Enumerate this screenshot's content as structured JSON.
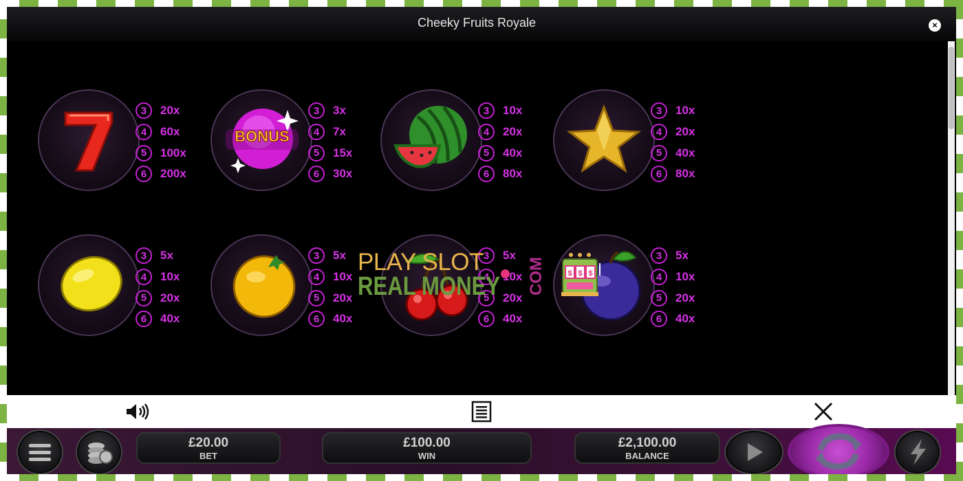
{
  "window": {
    "title": "Cheeky Fruits Royale",
    "close_label": "×"
  },
  "paytable": {
    "symbols": [
      {
        "name": "seven-icon",
        "pays": [
          {
            "n": "3",
            "m": "20x"
          },
          {
            "n": "4",
            "m": "60x"
          },
          {
            "n": "5",
            "m": "100x"
          },
          {
            "n": "6",
            "m": "200x"
          }
        ]
      },
      {
        "name": "bonus-icon",
        "label": "BONUS",
        "pays": [
          {
            "n": "3",
            "m": "3x"
          },
          {
            "n": "4",
            "m": "7x"
          },
          {
            "n": "5",
            "m": "15x"
          },
          {
            "n": "6",
            "m": "30x"
          }
        ]
      },
      {
        "name": "watermelon-icon",
        "pays": [
          {
            "n": "3",
            "m": "10x"
          },
          {
            "n": "4",
            "m": "20x"
          },
          {
            "n": "5",
            "m": "40x"
          },
          {
            "n": "6",
            "m": "80x"
          }
        ]
      },
      {
        "name": "star-icon",
        "pays": [
          {
            "n": "3",
            "m": "10x"
          },
          {
            "n": "4",
            "m": "20x"
          },
          {
            "n": "5",
            "m": "40x"
          },
          {
            "n": "6",
            "m": "80x"
          }
        ]
      },
      {
        "name": "lemon-icon",
        "pays": [
          {
            "n": "3",
            "m": "5x"
          },
          {
            "n": "4",
            "m": "10x"
          },
          {
            "n": "5",
            "m": "20x"
          },
          {
            "n": "6",
            "m": "40x"
          }
        ]
      },
      {
        "name": "orange-icon",
        "pays": [
          {
            "n": "3",
            "m": "5x"
          },
          {
            "n": "4",
            "m": "10x"
          },
          {
            "n": "5",
            "m": "20x"
          },
          {
            "n": "6",
            "m": "40x"
          }
        ]
      },
      {
        "name": "cherry-icon",
        "pays": [
          {
            "n": "3",
            "m": "5x"
          },
          {
            "n": "4",
            "m": "10x"
          },
          {
            "n": "5",
            "m": "20x"
          },
          {
            "n": "6",
            "m": "40x"
          }
        ]
      },
      {
        "name": "plum-icon",
        "pays": [
          {
            "n": "3",
            "m": "5x"
          },
          {
            "n": "4",
            "m": "10x"
          },
          {
            "n": "5",
            "m": "20x"
          },
          {
            "n": "6",
            "m": "40x"
          }
        ]
      }
    ]
  },
  "watermark": {
    "line1": "PLAY SLOT",
    "line2": "REAL MONEY",
    "suffix": "COM"
  },
  "toolbar": {
    "sound": "speaker-icon",
    "info": "document-icon",
    "close": "close-icon"
  },
  "bottom": {
    "bet": {
      "value": "£20.00",
      "label": "BET"
    },
    "win": {
      "value": "£100.00",
      "label": "WIN"
    },
    "balance": {
      "value": "£2,100.00",
      "label": "BALANCE"
    }
  },
  "colors": {
    "accent": "#d632e6",
    "border": "#7cb342"
  }
}
